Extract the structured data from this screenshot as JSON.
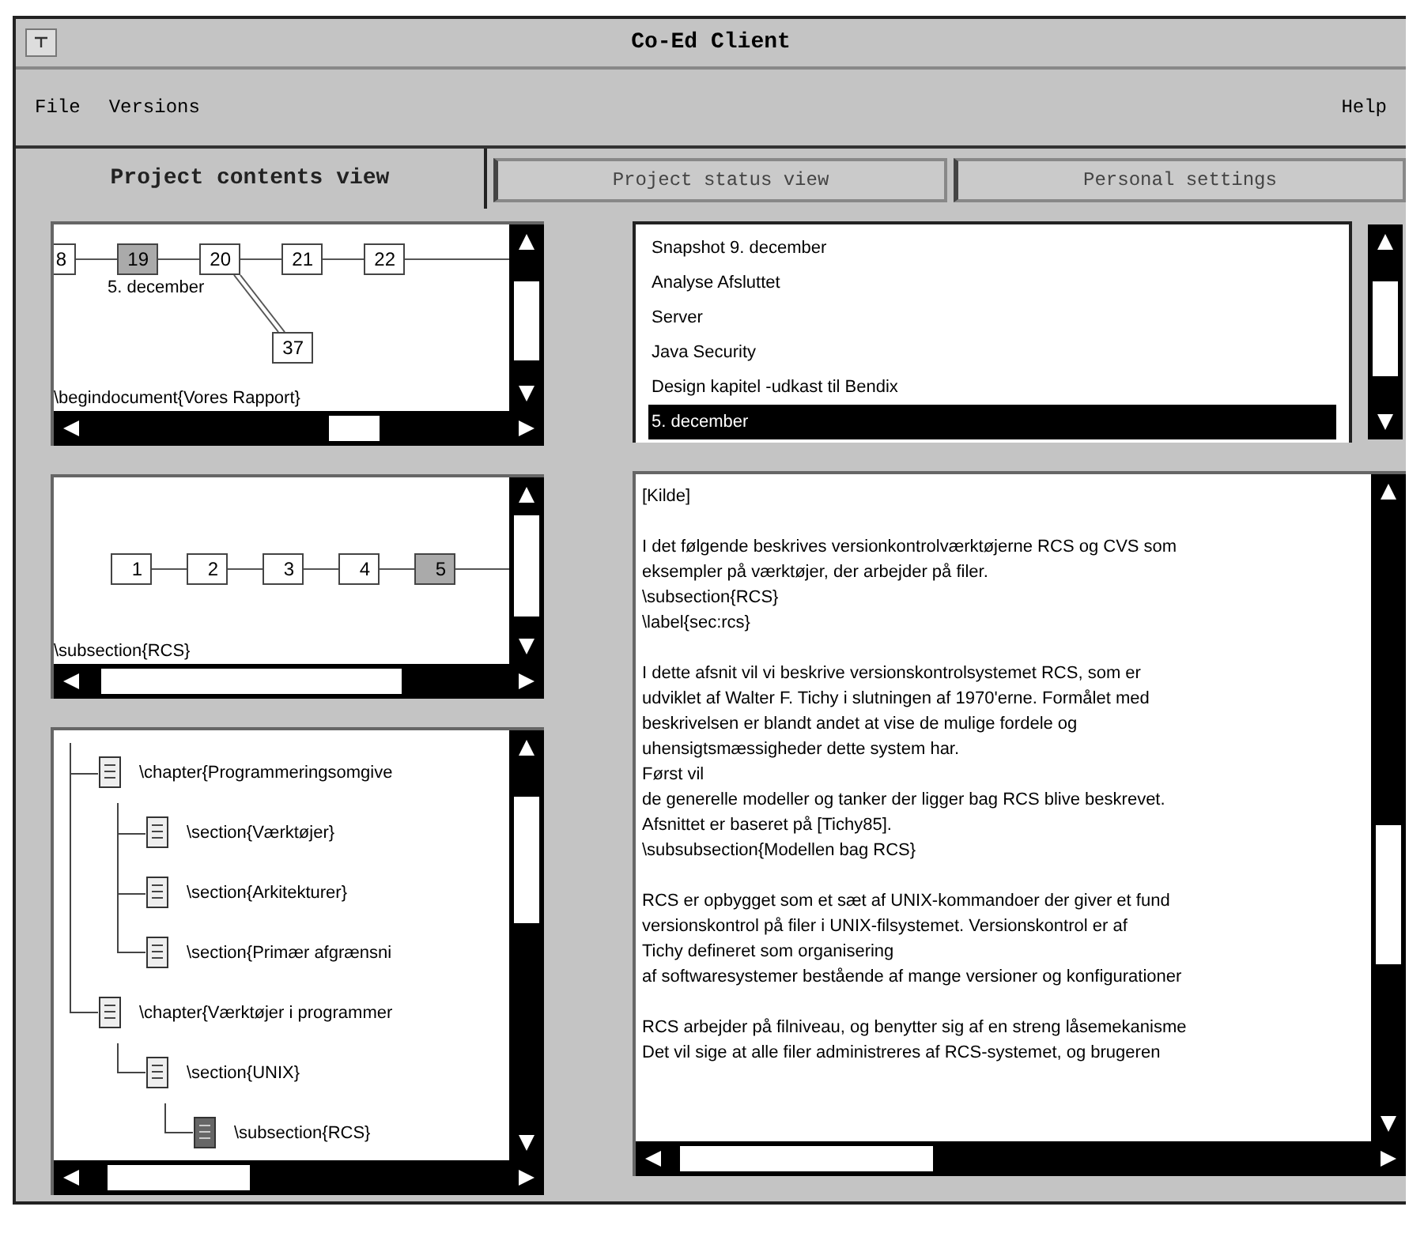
{
  "window": {
    "title": "Co-Ed Client"
  },
  "menu": {
    "left": [
      "File",
      "Versions"
    ],
    "right": [
      "Help"
    ]
  },
  "tabs": [
    {
      "label": "Project contents view",
      "selected": true
    },
    {
      "label": "Project status view",
      "selected": false
    },
    {
      "label": "Personal settings",
      "selected": false
    }
  ],
  "version_graph": {
    "label": "\\begindocument{Vores Rapport}",
    "nodes": [
      {
        "label": "8",
        "selected": false
      },
      {
        "label": "19",
        "selected": true,
        "caption": "5. december"
      },
      {
        "label": "20",
        "selected": false,
        "children": [
          {
            "label": "37",
            "selected": false
          }
        ]
      },
      {
        "label": "21",
        "selected": false
      },
      {
        "label": "22",
        "selected": false
      }
    ]
  },
  "section_graph": {
    "label": "\\subsection{RCS}",
    "nodes": [
      {
        "label": "1",
        "selected": false
      },
      {
        "label": "2",
        "selected": false
      },
      {
        "label": "3",
        "selected": false
      },
      {
        "label": "4",
        "selected": false
      },
      {
        "label": "5",
        "selected": true
      }
    ]
  },
  "outline": [
    {
      "label": "\\chapter{Programmeringsomgive",
      "selected": false,
      "children": [
        {
          "label": "\\section{Værktøjer}",
          "selected": false
        },
        {
          "label": "\\section{Arkitekturer}",
          "selected": false
        },
        {
          "label": "\\section{Primær afgrænsni",
          "selected": false
        }
      ]
    },
    {
      "label": "\\chapter{Værktøjer i programmer",
      "selected": false,
      "children": [
        {
          "label": "\\section{UNIX}",
          "selected": false,
          "children": [
            {
              "label": "\\subsection{RCS}",
              "selected": true
            }
          ]
        }
      ]
    }
  ],
  "snapshots": [
    {
      "label": "Snapshot 9. december",
      "selected": false
    },
    {
      "label": "Analyse Afsluttet",
      "selected": false
    },
    {
      "label": "Server",
      "selected": false
    },
    {
      "label": "Java Security",
      "selected": false
    },
    {
      "label": "Design kapitel -udkast til Bendix",
      "selected": false
    },
    {
      "label": "5. december",
      "selected": true
    }
  ],
  "document": [
    [
      "[Kilde]"
    ],
    [
      "I det følgende beskrives versionkontrolværktøjerne RCS og CVS som",
      "eksempler på værktøjer, der arbejder på filer.",
      "\\subsection{RCS}",
      "\\label{sec:rcs}"
    ],
    [
      "I dette afsnit vil vi beskrive versionskontrolsystemet RCS, som er",
      "udviklet af Walter F. Tichy i slutningen af 1970'erne. Formålet med",
      "beskrivelsen er blandt andet at vise de mulige fordele og",
      "uhensigtsmæssigheder dette system har.",
      "Først vil",
      "de generelle modeller og tanker der ligger bag RCS blive beskrevet.",
      "Afsnittet er baseret på [Tichy85].",
      "\\subsubsection{Modellen bag RCS}"
    ],
    [
      "RCS er opbygget som et sæt af UNIX-kommandoer der giver et fund",
      "versionskontrol på filer i UNIX-filsystemet. Versionskontrol er af",
      "Tichy defineret som organisering",
      "af softwaresystemer bestående af mange versioner og konfigurationer"
    ],
    [
      "RCS arbejder på filniveau, og benytter sig af en streng låsemekanisme",
      "Det vil sige at alle filer administreres af RCS-systemet, og brugeren"
    ]
  ]
}
